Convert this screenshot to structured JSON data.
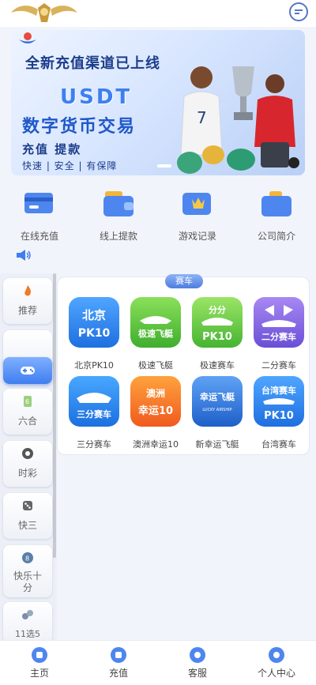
{
  "header": {
    "logo_icon": "winged-crest-logo-icon",
    "chat_icon": "chat-bubble-icon"
  },
  "banner": {
    "title": "全新充值渠道已上线",
    "currency": "USDT",
    "subtitle": "数字货币交易",
    "line": "充值 提款",
    "slogan": "快速 | 安全 | 有保障"
  },
  "quick_actions": [
    {
      "label": "在线充值",
      "icon": "card-icon"
    },
    {
      "label": "线上提款",
      "icon": "wallet-icon"
    },
    {
      "label": "游戏记录",
      "icon": "record-icon"
    },
    {
      "label": "公司简介",
      "icon": "briefcase-icon"
    }
  ],
  "notice_icon": "speaker-icon",
  "sidebar": [
    {
      "label": "推荐",
      "icon": "fire-icon",
      "active": false
    },
    {
      "label": "",
      "icon": "gamepad-icon",
      "active": true
    },
    {
      "label": "六合",
      "icon": "lotto-icon",
      "active": false
    },
    {
      "label": "时彩",
      "icon": "ball-icon",
      "active": false
    },
    {
      "label": "快三",
      "icon": "dice-icon",
      "active": false
    },
    {
      "label": "快乐十分",
      "icon": "coin-icon",
      "active": false
    },
    {
      "label": "11选5",
      "icon": "balls-icon",
      "active": false
    }
  ],
  "panel": {
    "tag": "赛车",
    "games": [
      {
        "label": "北京PK10",
        "logo_text": "北京",
        "logo_sub": "PK10",
        "color": "#2f8cf0"
      },
      {
        "label": "极速飞艇",
        "logo_text": "极速飞艇",
        "logo_sub": "",
        "color": "#5cc63a"
      },
      {
        "label": "极速赛车",
        "logo_text": "分分",
        "logo_sub": "PK10",
        "color": "#6fc83a"
      },
      {
        "label": "二分赛车",
        "logo_text": "二分赛车",
        "logo_sub": "",
        "color": "#8a66e0"
      },
      {
        "label": "三分赛车",
        "logo_text": "三分赛车",
        "logo_sub": "",
        "color": "#2d8ef2"
      },
      {
        "label": "澳洲幸运10",
        "logo_text": "澳洲",
        "logo_sub": "幸运10",
        "color": "#f57b2e"
      },
      {
        "label": "新幸运飞艇",
        "logo_text": "幸运飞艇",
        "logo_sub": "LUCKY AIRSHIP",
        "color": "#2f7de8"
      },
      {
        "label": "台湾赛车",
        "logo_text": "台湾赛车",
        "logo_sub": "PK10",
        "color": "#2f8cf0"
      }
    ]
  },
  "tabbar": [
    {
      "label": "主页",
      "icon": "home-icon"
    },
    {
      "label": "充值",
      "icon": "recharge-icon"
    },
    {
      "label": "客服",
      "icon": "support-icon"
    },
    {
      "label": "个人中心",
      "icon": "user-icon"
    }
  ]
}
